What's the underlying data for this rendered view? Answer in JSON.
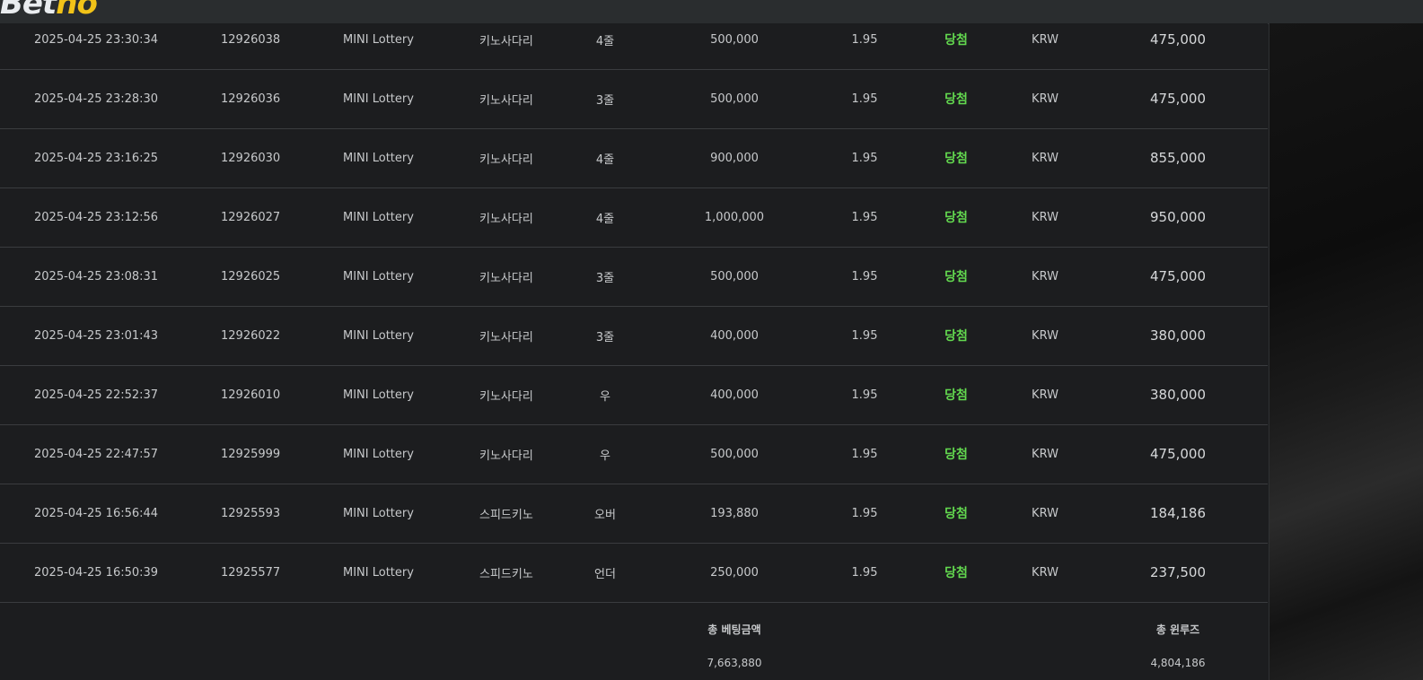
{
  "header": {
    "logo_part1": "Bet",
    "logo_part2": "no"
  },
  "rows": [
    {
      "date": "2025-04-25 23:30:34",
      "id": "12926038",
      "game": "MINI Lottery",
      "type": "키노사다리",
      "pick": "4줄",
      "amount": "500,000",
      "odds": "1.95",
      "result": "당첨",
      "currency": "KRW",
      "win": "475,000"
    },
    {
      "date": "2025-04-25 23:28:30",
      "id": "12926036",
      "game": "MINI Lottery",
      "type": "키노사다리",
      "pick": "3줄",
      "amount": "500,000",
      "odds": "1.95",
      "result": "당첨",
      "currency": "KRW",
      "win": "475,000"
    },
    {
      "date": "2025-04-25 23:16:25",
      "id": "12926030",
      "game": "MINI Lottery",
      "type": "키노사다리",
      "pick": "4줄",
      "amount": "900,000",
      "odds": "1.95",
      "result": "당첨",
      "currency": "KRW",
      "win": "855,000"
    },
    {
      "date": "2025-04-25 23:12:56",
      "id": "12926027",
      "game": "MINI Lottery",
      "type": "키노사다리",
      "pick": "4줄",
      "amount": "1,000,000",
      "odds": "1.95",
      "result": "당첨",
      "currency": "KRW",
      "win": "950,000"
    },
    {
      "date": "2025-04-25 23:08:31",
      "id": "12926025",
      "game": "MINI Lottery",
      "type": "키노사다리",
      "pick": "3줄",
      "amount": "500,000",
      "odds": "1.95",
      "result": "당첨",
      "currency": "KRW",
      "win": "475,000"
    },
    {
      "date": "2025-04-25 23:01:43",
      "id": "12926022",
      "game": "MINI Lottery",
      "type": "키노사다리",
      "pick": "3줄",
      "amount": "400,000",
      "odds": "1.95",
      "result": "당첨",
      "currency": "KRW",
      "win": "380,000"
    },
    {
      "date": "2025-04-25 22:52:37",
      "id": "12926010",
      "game": "MINI Lottery",
      "type": "키노사다리",
      "pick": "우",
      "amount": "400,000",
      "odds": "1.95",
      "result": "당첨",
      "currency": "KRW",
      "win": "380,000"
    },
    {
      "date": "2025-04-25 22:47:57",
      "id": "12925999",
      "game": "MINI Lottery",
      "type": "키노사다리",
      "pick": "우",
      "amount": "500,000",
      "odds": "1.95",
      "result": "당첨",
      "currency": "KRW",
      "win": "475,000"
    },
    {
      "date": "2025-04-25 16:56:44",
      "id": "12925593",
      "game": "MINI Lottery",
      "type": "스피드키노",
      "pick": "오버",
      "amount": "193,880",
      "odds": "1.95",
      "result": "당첨",
      "currency": "KRW",
      "win": "184,186"
    },
    {
      "date": "2025-04-25 16:50:39",
      "id": "12925577",
      "game": "MINI Lottery",
      "type": "스피드키노",
      "pick": "언더",
      "amount": "250,000",
      "odds": "1.95",
      "result": "당첨",
      "currency": "KRW",
      "win": "237,500"
    }
  ],
  "summary": {
    "total_bet_label": "총 베팅금액",
    "total_bet_value": "7,663,880",
    "total_win_label": "총 윈루즈",
    "total_win_value": "4,804,186"
  },
  "colors": {
    "win_result": "#63d94f",
    "logo_accent": "#f2c318",
    "background": "#1c1d1f"
  }
}
